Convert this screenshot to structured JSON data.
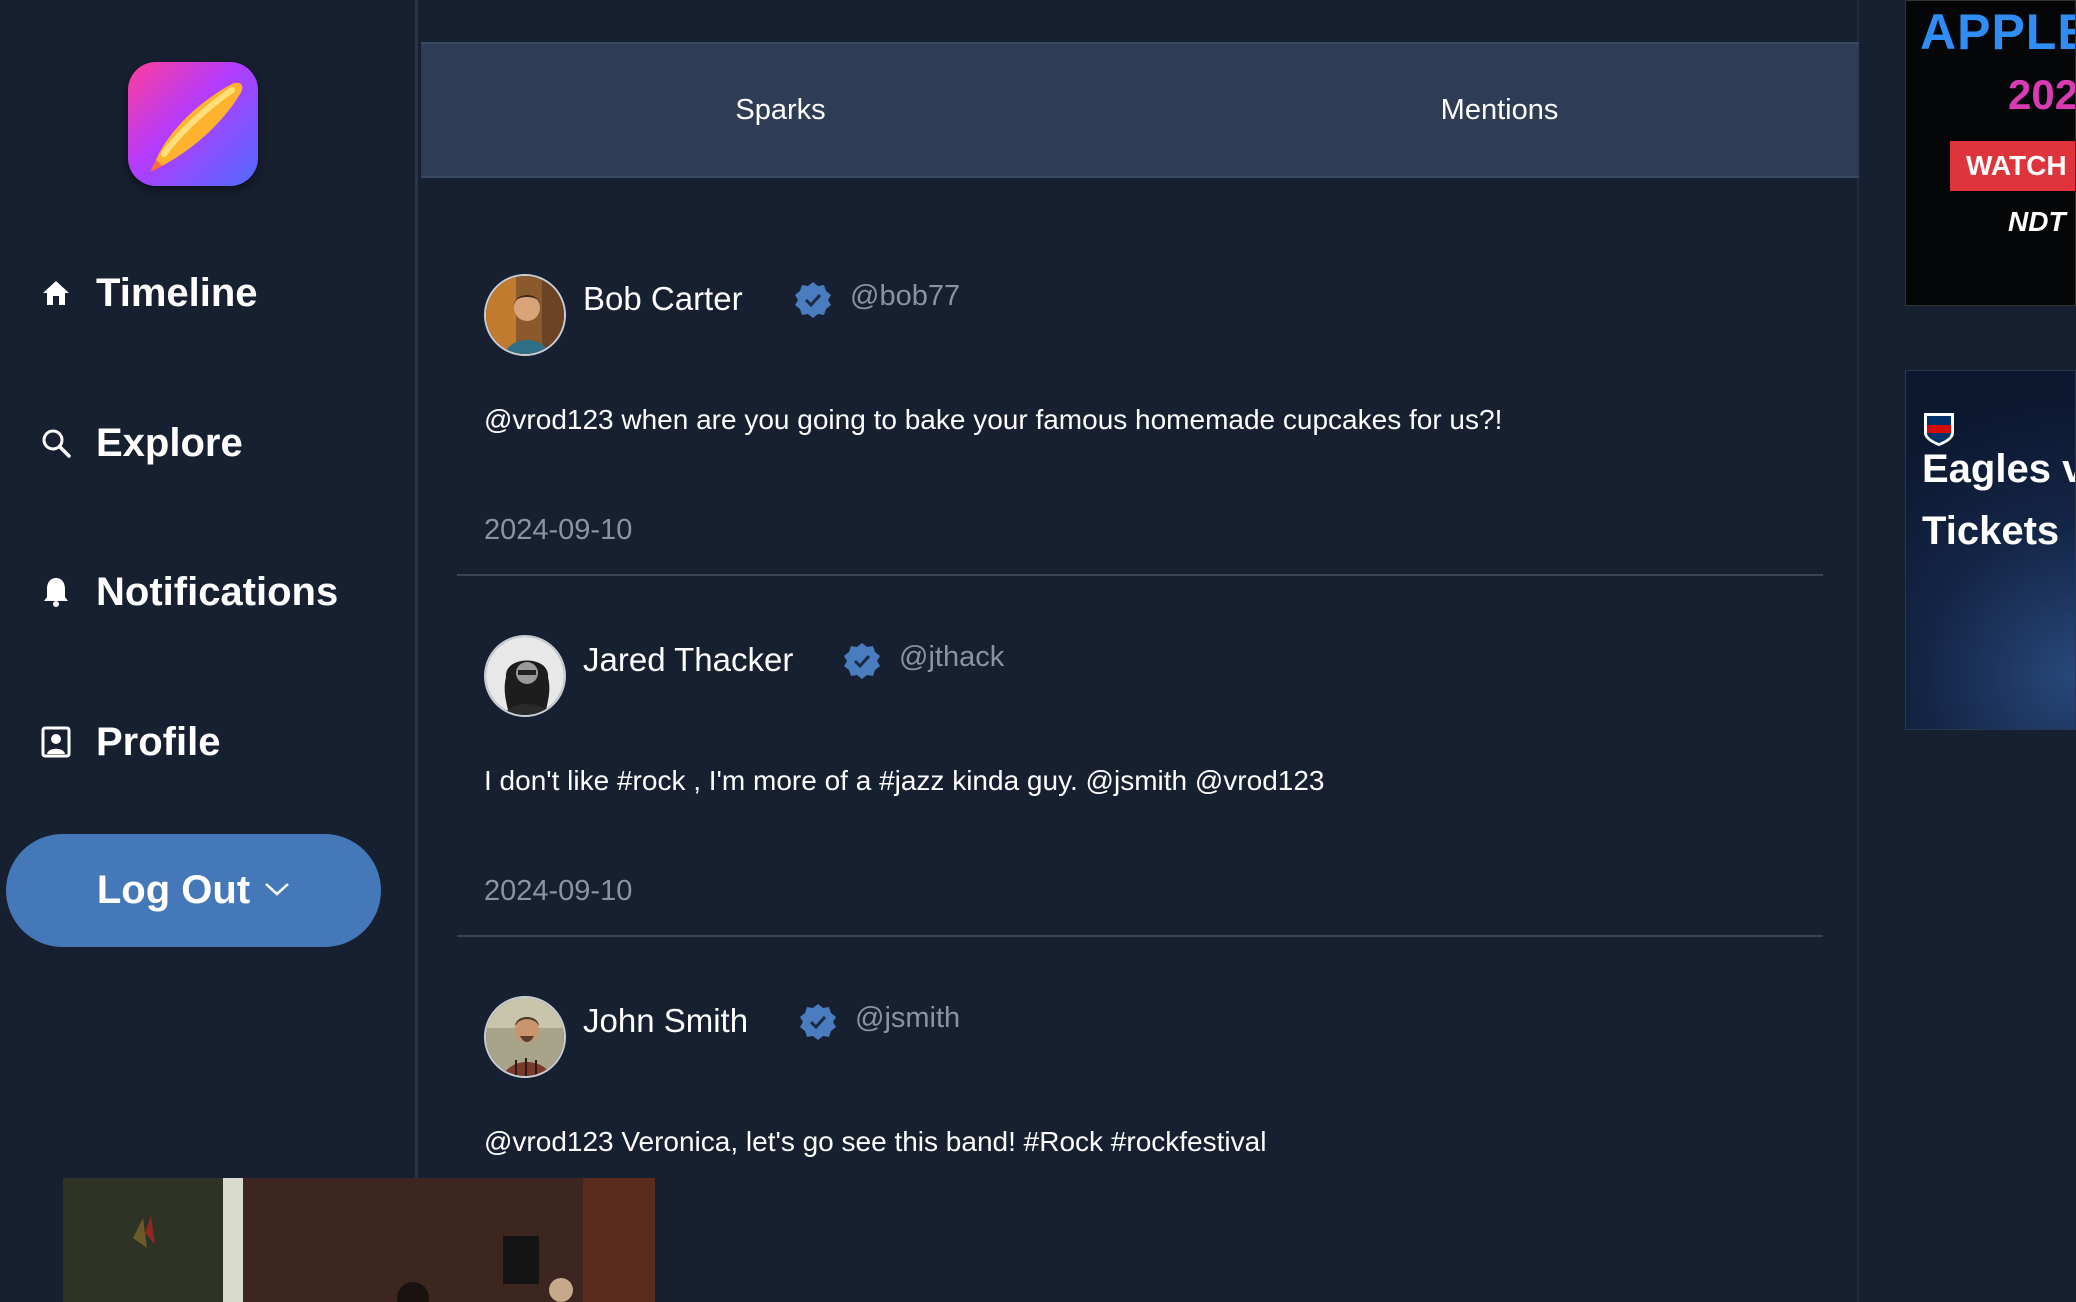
{
  "nav": {
    "items": [
      {
        "label": "Timeline",
        "icon": "home-icon"
      },
      {
        "label": "Explore",
        "icon": "search-icon"
      },
      {
        "label": "Notifications",
        "icon": "bell-icon"
      },
      {
        "label": "Profile",
        "icon": "profile-icon"
      }
    ],
    "logout_label": "Log Out"
  },
  "tabs": [
    {
      "label": "Sparks"
    },
    {
      "label": "Mentions"
    }
  ],
  "posts": [
    {
      "name": "Bob Carter",
      "handle": "@bob77",
      "verified": true,
      "text": "@vrod123 when are you going to bake your famous homemade cupcakes for us?!",
      "date": "2024-09-10"
    },
    {
      "name": "Jared Thacker",
      "handle": "@jthack",
      "verified": true,
      "text": "I don't like #rock , I'm more of a #jazz kinda guy. @jsmith @vrod123",
      "date": "2024-09-10"
    },
    {
      "name": "John Smith",
      "handle": "@jsmith",
      "verified": true,
      "text": "@vrod123 Veronica, let's go see this band! #Rock #rockfestival",
      "date": ""
    }
  ],
  "ads": {
    "ad1": {
      "line1": "APPLE I",
      "line2": "202",
      "cta": "WATCH",
      "brand": "NDT"
    },
    "ad2": {
      "line1": "Eagles v",
      "line2": "Tickets"
    }
  },
  "colors": {
    "background": "#172030",
    "tab_bar": "#2e3d55",
    "accent": "#4578b8",
    "verified": "#4a7cc0",
    "muted_text": "#8b93a2"
  }
}
